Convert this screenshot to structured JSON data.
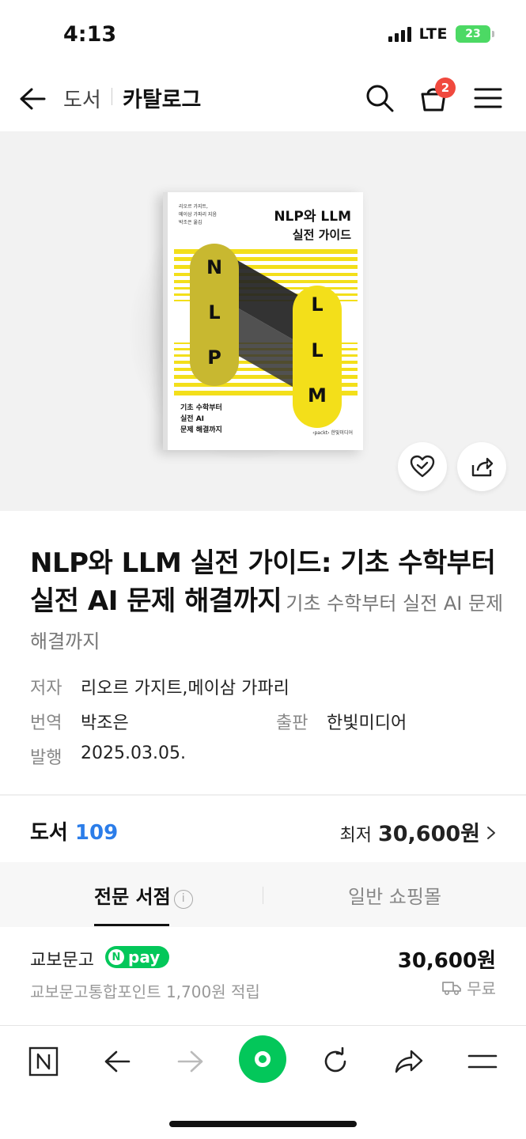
{
  "status_bar": {
    "time": "4:13",
    "network": "LTE",
    "battery": "23"
  },
  "header": {
    "breadcrumb": "도서",
    "title": "카탈로그",
    "cart_count": "2"
  },
  "book_cover": {
    "title_line1": "NLP와 LLM",
    "title_line2": "실전 가이드",
    "authors_line1": "리오르 가지트,",
    "authors_line2": "메이삼 가파리 지음",
    "translator": "박조은 옮김",
    "left_letters": [
      "N",
      "L",
      "P"
    ],
    "right_letters": [
      "L",
      "L",
      "M"
    ],
    "tagline_line1": "기초 수학부터",
    "tagline_line2": "실전 AI",
    "tagline_line3": "문제 해결까지",
    "publisher_mark": "‹packt› 한빛미디어",
    "accent_color": "#f3df1a"
  },
  "product": {
    "title": "NLP와 LLM 실전 가이드: 기초 수학부터 실전 AI 문제 해결까지",
    "subtitle": "기초 수학부터 실전 AI 문제 해결까지",
    "meta": {
      "author_label": "저자",
      "author": "리오르 가지트,메이삼 가파리",
      "translator_label": "번역",
      "translator": "박조은",
      "publisher_label": "출판",
      "publisher": "한빛미디어",
      "published_label": "발행",
      "published": "2025.03.05."
    }
  },
  "price_summary": {
    "category": "도서",
    "count": "109",
    "lowest_label": "최저",
    "lowest_price": "30,600원"
  },
  "tabs": [
    {
      "label": "전문 서점",
      "active": true
    },
    {
      "label": "일반 쇼핑몰",
      "active": false
    }
  ],
  "seller": {
    "name": "교보문고",
    "pay_badge": "pay",
    "point_text": "교보문고통합포인트 1,700원 적립",
    "price": "30,600원",
    "shipping": "무료"
  },
  "bottom_nav": [
    "naver-logo-icon",
    "back-arrow-icon",
    "forward-arrow-icon",
    "green-dot-icon",
    "refresh-icon",
    "share-icon",
    "menu-icon"
  ],
  "colors": {
    "link_blue": "#2b7de9",
    "npay_green": "#03c75a",
    "badge_red": "#f0493e"
  }
}
